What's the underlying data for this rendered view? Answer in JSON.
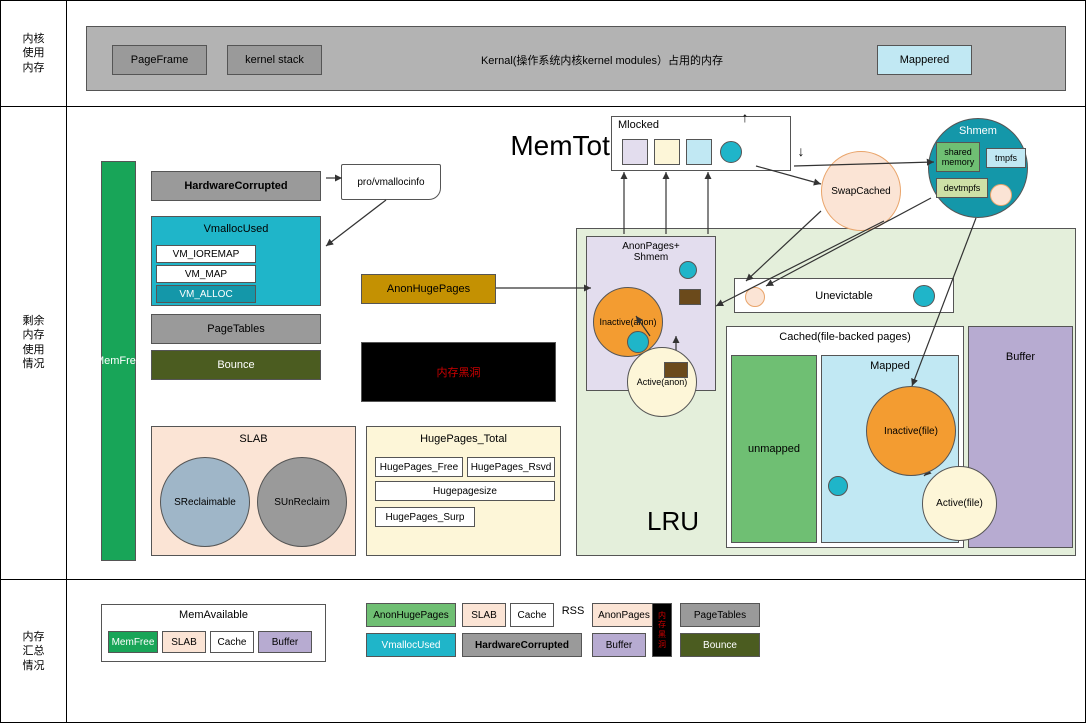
{
  "sections": {
    "kernel_mem": "内核\n使用\n内存",
    "remaining": "剩余\n内存\n使用\n情况",
    "summary": "内存\n汇总\n情况"
  },
  "kernel_bar": {
    "pageframe": "PageFrame",
    "kstack": "kernel stack",
    "desc": "Kernal(操作系统内核kernel modules）占用的内存",
    "mappered": "Mappered"
  },
  "mid": {
    "memtotal": "MemTotal",
    "memfree": "MemFree",
    "hwcorrupt": "HardwareCorrupted",
    "vmallocused": "VmallocUsed",
    "vm_ioremap": "VM_IOREMAP",
    "vm_map": "VM_MAP",
    "vm_alloc": "VM_ALLOC",
    "pagetables": "PageTables",
    "bounce": "Bounce",
    "procvmalloc": "pro/vmallocinfo",
    "anonhuge": "AnonHugePages",
    "blackhole": "内存黑洞",
    "slab": "SLAB",
    "sreclaim": "SReclaimable",
    "sunreclaim": "SUnReclaim",
    "hugetotal": "HugePages_Total",
    "hugefree": "HugePages_Free",
    "hugersvd": "HugePages_Rsvd",
    "hugesize": "Hugepagesize",
    "hugesurp": "HugePages_Surp",
    "lru": "LRU",
    "mlocked": "Mlocked",
    "anonshmem": "AnonPages+\nShmem",
    "inactive_anon": "Inactive(anon)",
    "active_anon": "Active(anon)",
    "swapcached": "SwapCached",
    "unevictable": "Unevictable",
    "cached": "Cached(file-backed pages)",
    "unmapped": "unmapped",
    "mapped": "Mapped",
    "buffer": "Buffer",
    "inactive_file": "Inactive(file)",
    "active_file": "Active(file)",
    "shmem": "Shmem",
    "sharedmem": "shared\nmemory",
    "tmpfs": "tmpfs",
    "devtmpfs": "devtmpfs"
  },
  "summary": {
    "memavail": "MemAvailable",
    "memfree": "MemFree",
    "slab": "SLAB",
    "cache": "Cache",
    "buffer": "Buffer",
    "anonhuge": "AnonHugePages",
    "slab2": "SLAB",
    "cache2": "Cache",
    "rss": "RSS",
    "anonpages": "AnonPages",
    "pagetables": "PageTables",
    "vmallocused": "VmallocUsed",
    "hwcorrupt": "HardwareCorrupted",
    "buffer2": "Buffer",
    "blackhole": "内\n存\n黑\n洞",
    "bounce": "Bounce"
  },
  "colors": {
    "gray": "#b3b3b3",
    "darkgray": "#9a9a9a",
    "teal": "#1fb5c9",
    "lightblue": "#c1e8f3",
    "olive": "#4b5c20",
    "gold": "#c49102",
    "black": "#000000",
    "peach": "#fbe4d5",
    "peachOutline": "#e9a46a",
    "green": "#18a558",
    "lru": "#e4efdb",
    "lavender": "#e3ddee",
    "orange": "#f39c31",
    "cream": "#fdf6d8",
    "purple": "#b7abd1",
    "lightgreen": "#6fbf73",
    "tealdark": "#1497a9"
  }
}
